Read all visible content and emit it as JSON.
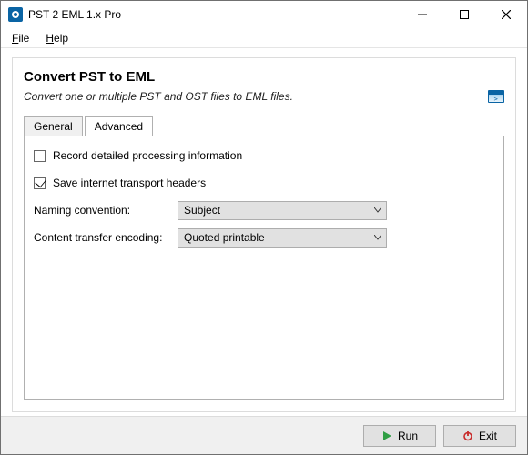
{
  "window": {
    "title": "PST 2 EML 1.x Pro"
  },
  "menubar": {
    "file": "File",
    "help": "Help"
  },
  "panel": {
    "title": "Convert PST to EML",
    "subtitle": "Convert one or multiple PST and OST files to EML files."
  },
  "tabs": {
    "general": "General",
    "advanced": "Advanced",
    "active": "advanced"
  },
  "advanced": {
    "record_detailed": {
      "label": "Record detailed processing information",
      "checked": false
    },
    "save_headers": {
      "label": "Save internet transport headers",
      "checked": true
    },
    "naming": {
      "label": "Naming convention:",
      "value": "Subject"
    },
    "encoding": {
      "label": "Content transfer encoding:",
      "value": "Quoted printable"
    }
  },
  "footer": {
    "run": "Run",
    "exit": "Exit"
  },
  "colors": {
    "accent_blue": "#0a64a4",
    "run_green": "#2f9e44",
    "exit_red": "#c92a2a"
  }
}
